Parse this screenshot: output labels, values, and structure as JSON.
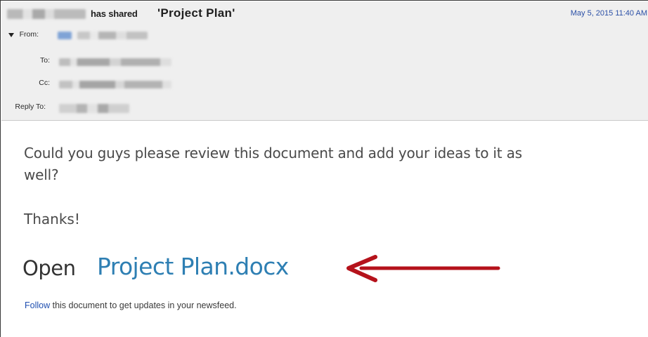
{
  "email": {
    "shared_text": "has shared",
    "subject": "'Project Plan'",
    "date": "May 5, 2015 11:40 AM",
    "fields": {
      "from_label": "From:",
      "to_label": "To:",
      "cc_label": "Cc:",
      "reply_to_label": "Reply To:"
    }
  },
  "body": {
    "message": "Could you guys please review this document and add your ideas to it as well?",
    "thanks": "Thanks!",
    "open_label": "Open",
    "doc_link": "Project Plan.docx",
    "follow_link": "Follow",
    "follow_text": " this document to get updates in your newsfeed."
  },
  "icons": {
    "arrow": "red-arrow-icon",
    "twisty": "collapse-triangle-icon"
  },
  "colors": {
    "link": "#2e7fb3",
    "arrow": "#b5121b",
    "date": "#2a4fa6"
  }
}
